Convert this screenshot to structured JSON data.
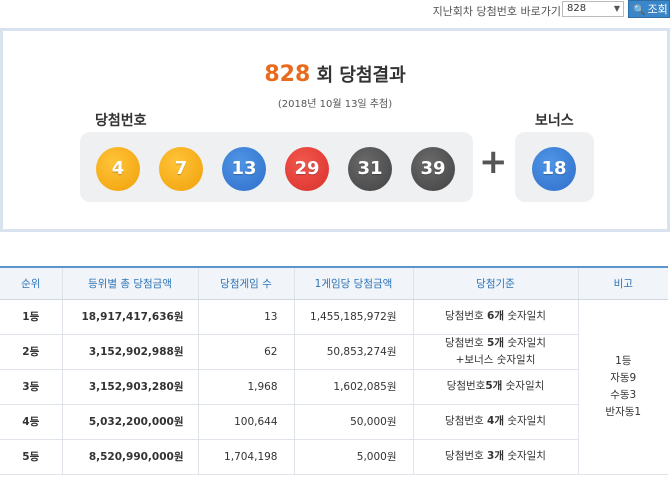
{
  "nav": {
    "label": "지난회차 당첨번호 바로가기",
    "selected_round": "828",
    "search_label": "조회"
  },
  "result": {
    "round_no": "828",
    "round_suffix": "회 당첨결과",
    "draw_date": "(2018년 10월 13일 추첨)",
    "win_label": "당첨번호",
    "bonus_label": "보너스",
    "plus": "+",
    "numbers": [
      {
        "value": "4",
        "color": "#f5b01a"
      },
      {
        "value": "7",
        "color": "#f5b01a"
      },
      {
        "value": "13",
        "color": "#3d82d9"
      },
      {
        "value": "29",
        "color": "#e2403a"
      },
      {
        "value": "31",
        "color": "#555555"
      },
      {
        "value": "39",
        "color": "#555555"
      }
    ],
    "bonus": {
      "value": "18",
      "color": "#3d82d9"
    }
  },
  "table": {
    "headers": [
      "순위",
      "등위별 총 당첨금액",
      "당첨게임 수",
      "1게임당 당첨금액",
      "당첨기준",
      "비고"
    ],
    "rows": [
      {
        "rank": "1등",
        "total": "18,917,417,636원",
        "games": "13",
        "per_game": "1,455,185,972원",
        "crit_a": "당첨번호 ",
        "crit_b": "6개",
        "crit_c": " 숫자일치",
        "crit_line2": ""
      },
      {
        "rank": "2등",
        "total": "3,152,902,988원",
        "games": "62",
        "per_game": "50,853,274원",
        "crit_a": "당첨번호 ",
        "crit_b": "5개",
        "crit_c": " 숫자일치",
        "crit_line2": "+보너스 숫자일치"
      },
      {
        "rank": "3등",
        "total": "3,152,903,280원",
        "games": "1,968",
        "per_game": "1,602,085원",
        "crit_a": "당첨번호",
        "crit_b": "5개",
        "crit_c": " 숫자일치",
        "crit_line2": ""
      },
      {
        "rank": "4등",
        "total": "5,032,200,000원",
        "games": "100,644",
        "per_game": "50,000원",
        "crit_a": "당첨번호 ",
        "crit_b": "4개",
        "crit_c": " 숫자일치",
        "crit_line2": ""
      },
      {
        "rank": "5등",
        "total": "8,520,990,000원",
        "games": "1,704,198",
        "per_game": "5,000원",
        "crit_a": "당첨번호 ",
        "crit_b": "3개",
        "crit_c": " 숫자일치",
        "crit_line2": ""
      }
    ],
    "note_lines": [
      "1등",
      "자동9",
      "수동3",
      "반자동1"
    ]
  }
}
